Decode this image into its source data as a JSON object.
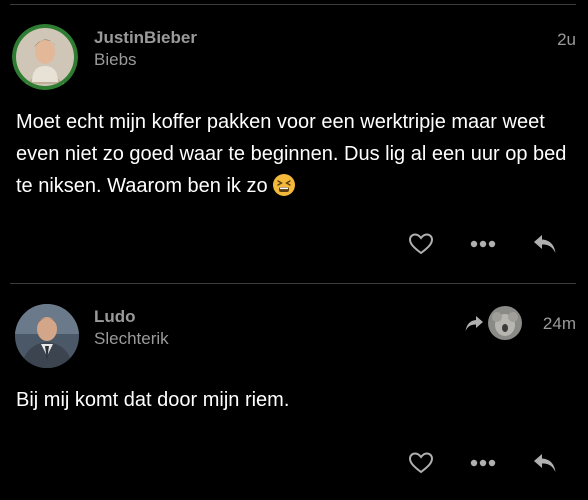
{
  "posts": [
    {
      "username": "JustinBieber",
      "fullname": "Biebs",
      "time": "2u",
      "text": "Moet echt mijn koffer pakken voor een werktripje maar weet even niet zo goed waar te beginnen. Dus lig al een uur op bed te niksen. Waarom ben ik zo",
      "emoji": "tired-face-emoji",
      "avatar_ring_color": "#2e7d32"
    },
    {
      "username": "Ludo",
      "fullname": "Slechterik",
      "time": "24m",
      "text": "Bij mij komt dat door mijn riem.",
      "reply_indicator": "reply-arrow-icon"
    }
  ],
  "actions": {
    "like_icon": "heart-icon",
    "more_icon": "ellipsis-icon",
    "reply_icon": "reply-icon"
  },
  "colors": {
    "background": "#000000",
    "muted_text": "#9a9a9a",
    "body_text": "#ffffff",
    "divider": "#3a3a3a",
    "icon": "#b0b0b0"
  }
}
